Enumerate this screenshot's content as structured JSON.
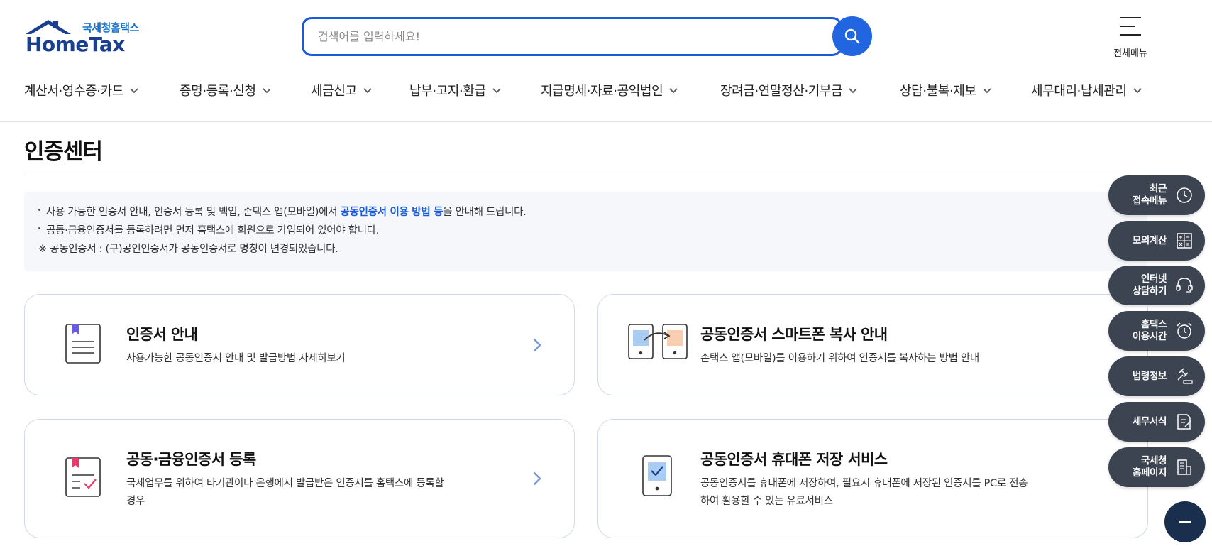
{
  "header": {
    "logo_sub": "국세청홈택스",
    "logo_main": "HomeTax",
    "search_placeholder": "검색어를 입력하세요!",
    "all_menu_label": "전체메뉴"
  },
  "gnb": [
    {
      "label": "계산서·영수증·카드"
    },
    {
      "label": "증명·등록·신청"
    },
    {
      "label": "세금신고"
    },
    {
      "label": "납부·고지·환급"
    },
    {
      "label": "지급명세·자료·공익법인"
    },
    {
      "label": "장려금·연말정산·기부금"
    },
    {
      "label": "상담·불복·제보"
    },
    {
      "label": "세무대리·납세관리"
    }
  ],
  "page_title": "인증센터",
  "notice": {
    "line1_pre": "사용 가능한 인증서 안내, 인증서 등록 및 백업, 손택스 앱(모바일)에서 ",
    "line1_em": "공동인증서 이용 방법 등",
    "line1_post": "을 안내해 드립니다.",
    "line2": "공동·금융인증서를 등록하려면 먼저 홈택스에 회원으로 가입되어 있어야 합니다.",
    "line3": "※ 공동인증서 : (구)공인인증서가 공동인증서로 명칭이 변경되었습니다."
  },
  "cards": [
    {
      "title": "인증서 안내",
      "desc": "사용가능한 공동인증서 안내 및 발급방법 자세히보기",
      "icon": "document-icon"
    },
    {
      "title": "공동인증서 스마트폰 복사 안내",
      "desc": "손택스 앱(모바일)를 이용하기 위하여 인증서를 복사하는 방법 안내",
      "icon": "phone-copy-icon"
    },
    {
      "title": "공동·금융인증서 등록",
      "desc": "국세업무를 위하여 타기관이나 은행에서 발급받은 인증서를 홈택스에 등록할 경우",
      "icon": "register-doc-icon"
    },
    {
      "title": "공동인증서 휴대폰 저장 서비스",
      "desc": "공동인증서를 휴대폰에 저장하여, 필요시 휴대폰에 저장된 인증서를 PC로 전송하여 활용할 수 있는 유료서비스",
      "icon": "phone-check-icon"
    }
  ],
  "quick_menu": [
    {
      "label": "최근\n접속메뉴",
      "icon": "clock-icon"
    },
    {
      "label": "모의계산",
      "icon": "calculator-icon"
    },
    {
      "label": "인터넷\n상담하기",
      "icon": "headset-icon"
    },
    {
      "label": "홈택스\n이용시간",
      "icon": "alarm-icon"
    },
    {
      "label": "법령정보",
      "icon": "gavel-icon"
    },
    {
      "label": "세무서식",
      "icon": "form-icon"
    },
    {
      "label": "국세청\n홈페이지",
      "icon": "building-icon"
    }
  ]
}
